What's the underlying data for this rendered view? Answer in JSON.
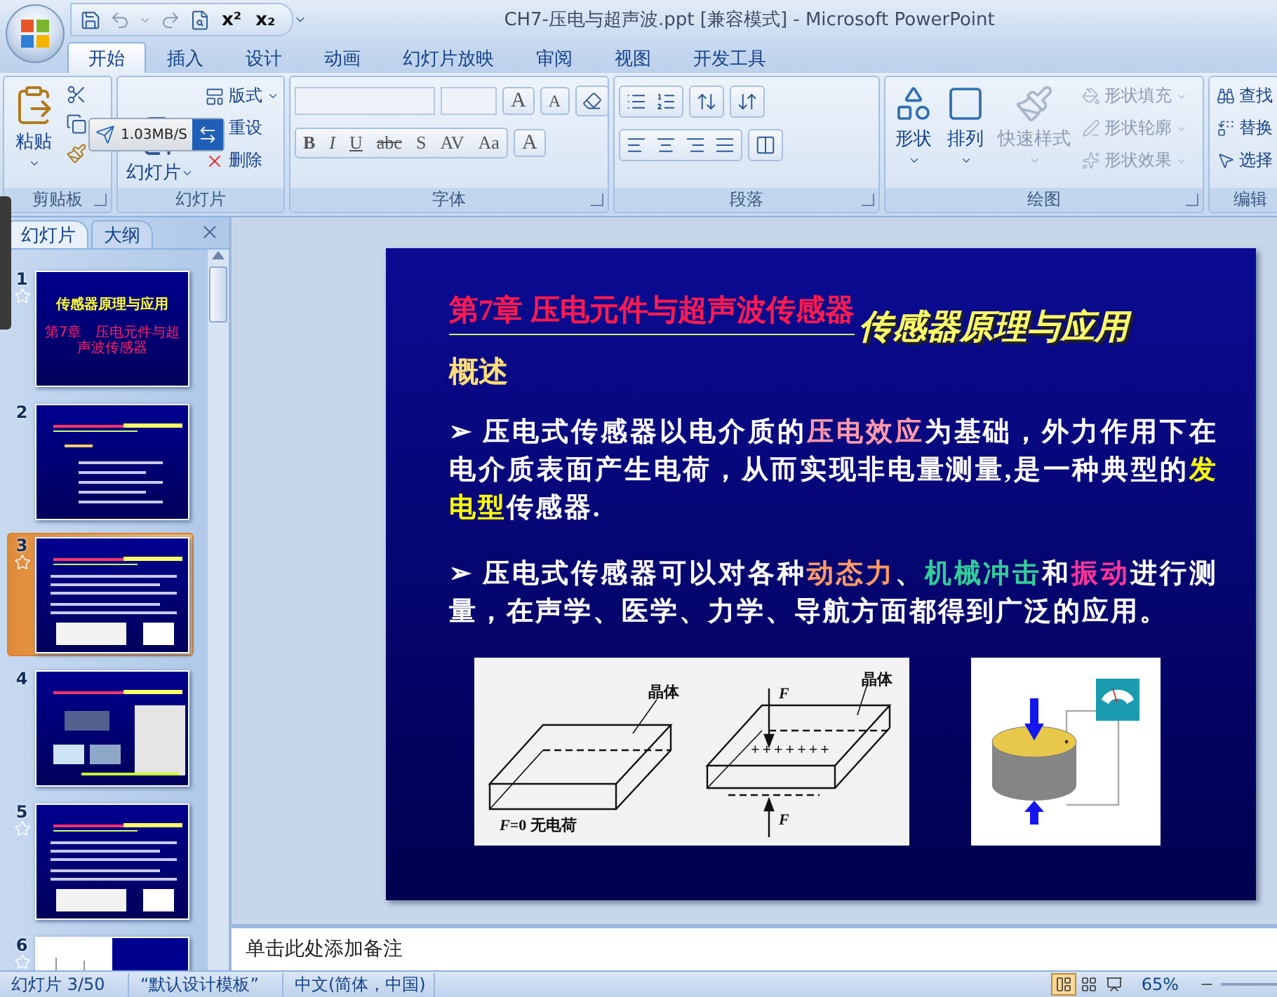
{
  "window": {
    "title": "CH7-压电与超声波.ppt [兼容模式] - Microsoft PowerPoint"
  },
  "quick_access": [
    "x²",
    "x₂"
  ],
  "ribbon_tabs": [
    {
      "label": "开始",
      "selected": true
    },
    {
      "label": "插入",
      "selected": false
    },
    {
      "label": "设计",
      "selected": false
    },
    {
      "label": "动画",
      "selected": false
    },
    {
      "label": "幻灯片放映",
      "selected": false
    },
    {
      "label": "审阅",
      "selected": false
    },
    {
      "label": "视图",
      "selected": false
    },
    {
      "label": "开发工具",
      "selected": false
    }
  ],
  "clipboard": {
    "title": "剪贴板",
    "paste": "粘贴"
  },
  "slides_group": {
    "title": "幻灯片",
    "new_slide": "幻灯片",
    "items": [
      "版式",
      "重设",
      "删除"
    ]
  },
  "font_group": {
    "title": "字体",
    "grow": "A",
    "shrink": "A",
    "format_buttons": [
      "B",
      "I",
      "U",
      "abc",
      "S",
      "AV",
      "Aa"
    ],
    "font_color": "A"
  },
  "paragraph_group": {
    "title": "段落"
  },
  "drawing_group": {
    "title": "绘图",
    "large": [
      {
        "label": "形状",
        "disabled": false
      },
      {
        "label": "排列",
        "disabled": false
      },
      {
        "label": "快速样式",
        "disabled": true
      }
    ],
    "small": [
      {
        "label": "形状填充",
        "disabled": true
      },
      {
        "label": "形状轮廓",
        "disabled": true
      },
      {
        "label": "形状效果",
        "disabled": true
      }
    ]
  },
  "editing_group": {
    "title": "编辑",
    "items": [
      "查找",
      "替换",
      "选择"
    ]
  },
  "speed_widget": {
    "reading": "1.03MB/S"
  },
  "panel_tabs": [
    {
      "label": "幻灯片",
      "selected": true
    },
    {
      "label": "大纲",
      "selected": false
    }
  ],
  "thumbnails": [
    {
      "number": "1",
      "kind": "title",
      "title": "传感器原理与应用",
      "subtitle": "第7章　压电元件与超声波传感器",
      "animated": true,
      "selected": false
    },
    {
      "number": "2",
      "kind": "outline",
      "animated": false,
      "selected": false
    },
    {
      "number": "3",
      "kind": "text_figures",
      "animated": true,
      "selected": true
    },
    {
      "number": "4",
      "kind": "photos",
      "animated": false,
      "selected": false
    },
    {
      "number": "5",
      "kind": "text_figures",
      "animated": true,
      "selected": false
    },
    {
      "number": "6",
      "kind": "image",
      "animated": true,
      "selected": false
    }
  ],
  "slide": {
    "chapter_title": "第7章  压电元件与超声波传感器",
    "course_title": "传感器原理与应用",
    "section": "概述",
    "paragraphs": [
      {
        "bullet": "➢",
        "segments": [
          {
            "text": "  压电式传感器以电介质的"
          },
          {
            "text": "压电效应",
            "color": "#ff99aa"
          },
          {
            "text": "为基础，外力作用下在电介质表面产生电荷，从而实现非电量测量,是一种典型的"
          },
          {
            "text": "发电型",
            "color": "#ffff00"
          },
          {
            "text": "传感器."
          }
        ]
      },
      {
        "bullet": "➢",
        "segments": [
          {
            "text": " 压电式传感器可以对各种"
          },
          {
            "text": "动态力",
            "color": "#ff9966"
          },
          {
            "text": "、"
          },
          {
            "text": "机械冲击",
            "color": "#33cc99"
          },
          {
            "text": "和"
          },
          {
            "text": "振动",
            "color": "#ff3399"
          },
          {
            "text": "进行测量，在声学、医学、力学、导航方面都得到广泛的应用。"
          }
        ]
      }
    ],
    "figure": {
      "crystal_left": "晶体",
      "crystal_right": "晶体",
      "force_top": "F",
      "force_bottom": "F",
      "charges": "+++++++",
      "no_charge": "*F*=0  无电荷"
    }
  },
  "notes": {
    "placeholder": "单击此处添加备注"
  },
  "status_bar": {
    "slide_info": "幻灯片 3/50",
    "theme": "“默认设计模板”",
    "language": "中文(简体，中国)",
    "zoom": "65%",
    "views": [
      {
        "selected": true
      },
      {
        "selected": false
      },
      {
        "selected": false
      }
    ]
  }
}
